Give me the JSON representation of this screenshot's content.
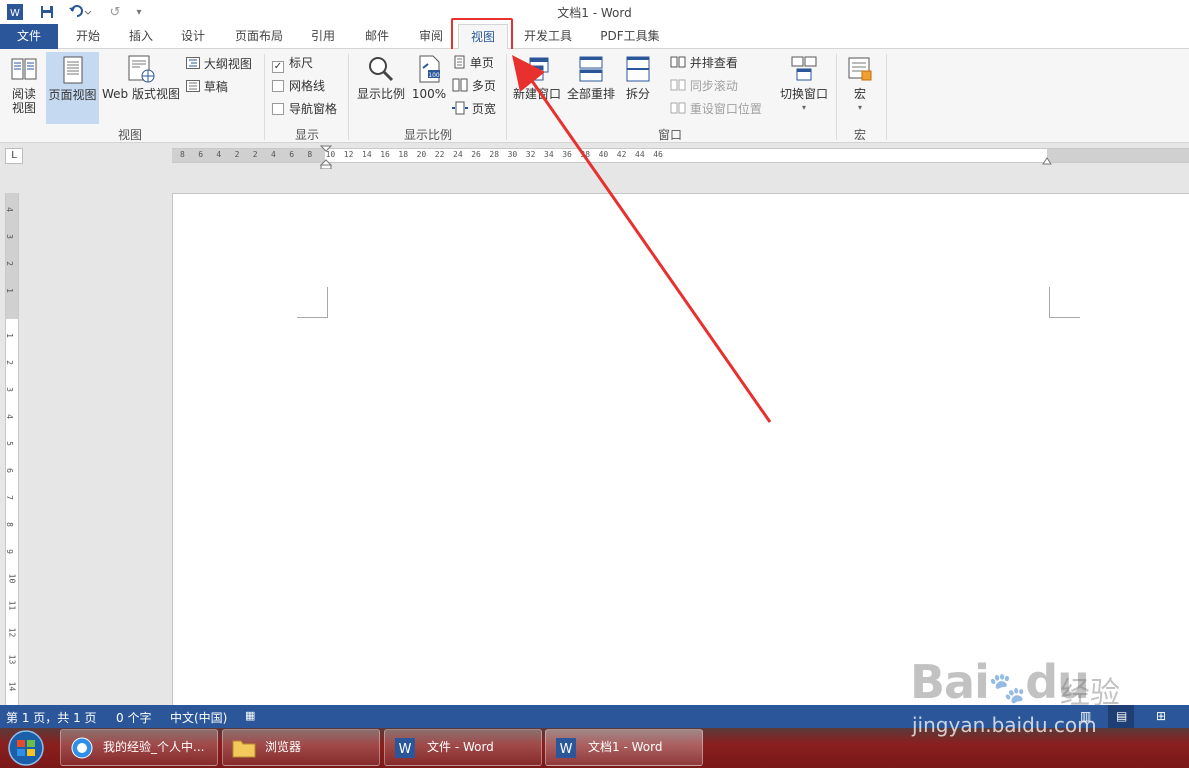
{
  "window": {
    "title": "文档1 - Word"
  },
  "tabs": [
    {
      "label": "文件"
    },
    {
      "label": "开始"
    },
    {
      "label": "插入"
    },
    {
      "label": "设计"
    },
    {
      "label": "页面布局"
    },
    {
      "label": "引用"
    },
    {
      "label": "邮件"
    },
    {
      "label": "审阅"
    },
    {
      "label": "视图"
    },
    {
      "label": "开发工具"
    },
    {
      "label": "PDF工具集"
    }
  ],
  "ribbon": {
    "views": {
      "read_mode_line1": "阅读",
      "read_mode_line2": "视图",
      "print_layout": "页面视图",
      "web_layout": "Web 版式视图",
      "outline": "大纲视图",
      "draft": "草稿",
      "group_label": "视图"
    },
    "show": {
      "ruler": "标尺",
      "gridlines": "网格线",
      "navigation_pane": "导航窗格",
      "ruler_checked": true,
      "gridlines_checked": false,
      "navigation_pane_checked": false,
      "group_label": "显示"
    },
    "zoom": {
      "zoom": "显示比例",
      "hundred": "100%",
      "one_page": "单页",
      "multiple_pages": "多页",
      "page_width": "页宽",
      "group_label": "显示比例"
    },
    "window": {
      "new_window": "新建窗口",
      "arrange_all": "全部重排",
      "split": "拆分",
      "side_by_side": "并排查看",
      "sync_scroll": "同步滚动",
      "reset_position": "重设窗口位置",
      "switch_windows": "切换窗口",
      "group_label": "窗口"
    },
    "macros": {
      "macros": "宏",
      "group_label": "宏"
    }
  },
  "ruler": {
    "h_labels": [
      "8",
      "6",
      "4",
      "2",
      "2",
      "4",
      "6",
      "8",
      "10",
      "12",
      "14",
      "16",
      "18",
      "20",
      "22",
      "24",
      "26",
      "28",
      "30",
      "32",
      "34",
      "36",
      "38",
      "40",
      "42",
      "44",
      "46"
    ],
    "v_labels": [
      "4",
      "3",
      "2",
      "1",
      "1",
      "2",
      "3",
      "4",
      "5",
      "6",
      "7",
      "8",
      "9",
      "10",
      "11",
      "12",
      "13",
      "14"
    ]
  },
  "statusbar": {
    "page": "第 1 页，共 1 页",
    "words": "0 个字",
    "language": "中文(中国)"
  },
  "taskbar": {
    "items": [
      {
        "label": "我的经验_个人中..."
      },
      {
        "label": "浏览器"
      },
      {
        "label": "文件 - Word"
      },
      {
        "label": "文档1 - Word"
      }
    ]
  },
  "watermark": {
    "brand": "Bai",
    "brand2": "du",
    "suffix": "经验",
    "url": "jingyan.baidu.com"
  },
  "colors": {
    "accent": "#2b579a",
    "highlight": "#e8302f",
    "taskbar": "#8a1f1f"
  }
}
